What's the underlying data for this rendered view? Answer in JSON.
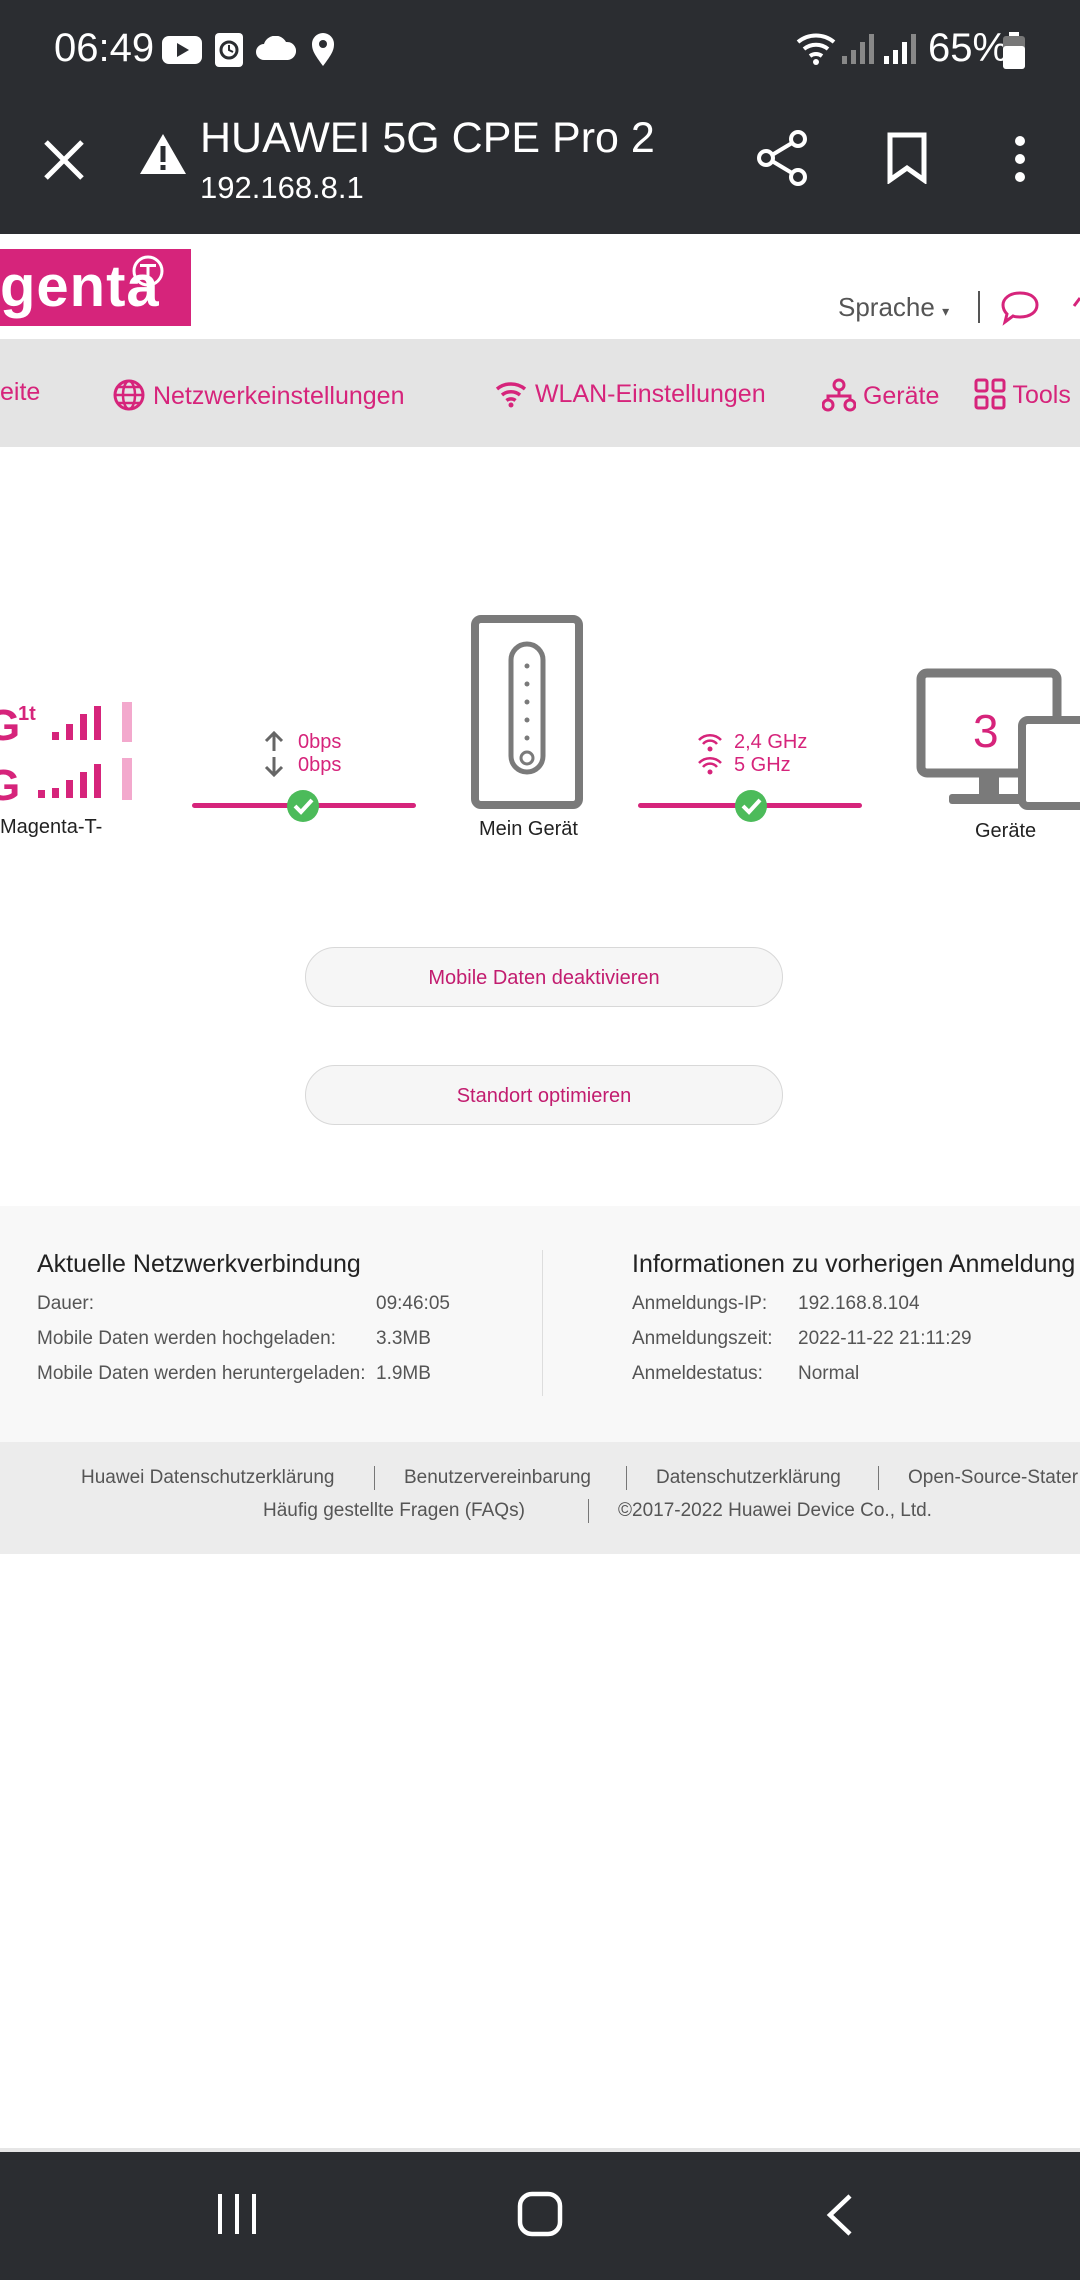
{
  "status_bar": {
    "time": "06:49",
    "battery": "65%",
    "icons": [
      "youtube-icon",
      "clock-icon",
      "cloud-icon",
      "location-icon",
      "wifi-icon",
      "signal-icon",
      "signal-icon",
      "battery-icon"
    ]
  },
  "browser": {
    "title": "HUAWEI 5G CPE Pro 2",
    "url": "192.168.8.1",
    "icons": [
      "close-icon",
      "warning-icon",
      "share-icon",
      "bookmark-icon",
      "more-icon"
    ]
  },
  "header": {
    "logo_text": "genta",
    "language": "Sprache"
  },
  "nav": {
    "items": [
      {
        "label": "eite",
        "icon": ""
      },
      {
        "label": "Netzwerkeinstellungen",
        "icon": "globe-icon"
      },
      {
        "label": "WLAN-Einstellungen",
        "icon": "wifi-icon"
      },
      {
        "label": "Geräte",
        "icon": "network-icon"
      },
      {
        "label": "Tools",
        "icon": "grid-icon"
      }
    ]
  },
  "diagram": {
    "network_caption": "Magenta-T-",
    "upload_speed": "0bps",
    "download_speed": "0bps",
    "device_caption": "Mein Gerät",
    "band_24": "2,4 GHz",
    "band_5": "5 GHz",
    "devices_count": "3",
    "devices_caption": "Geräte"
  },
  "buttons": {
    "mobile_data": "Mobile Daten deaktivieren",
    "location": "Standort optimieren"
  },
  "info": {
    "current": {
      "title": "Aktuelle Netzwerkverbindung",
      "rows": [
        {
          "label": "Dauer:",
          "value": "09:46:05"
        },
        {
          "label": "Mobile Daten werden hochgeladen:",
          "value": "3.3MB"
        },
        {
          "label": "Mobile Daten werden heruntergeladen:",
          "value": "1.9MB"
        }
      ]
    },
    "previous": {
      "title": "Informationen zu vorherigen Anmeldung",
      "rows": [
        {
          "label": "Anmeldungs-IP:",
          "value": "192.168.8.104"
        },
        {
          "label": "Anmeldungszeit:",
          "value": "2022-11-22 21:11:29"
        },
        {
          "label": "Anmeldestatus:",
          "value": "Normal"
        }
      ]
    }
  },
  "footer": {
    "links": [
      "Huawei Datenschutzerklärung",
      "Benutzervereinbarung",
      "Datenschutzerklärung",
      "Open-Source-Stater"
    ],
    "faq": "Häufig gestellte Fragen (FAQs)",
    "copyright": "©2017-2022 Huawei Device Co., Ltd."
  },
  "colors": {
    "brand": "#d6247b",
    "bar": "#2b2d31",
    "ok": "#4cbb5a"
  }
}
